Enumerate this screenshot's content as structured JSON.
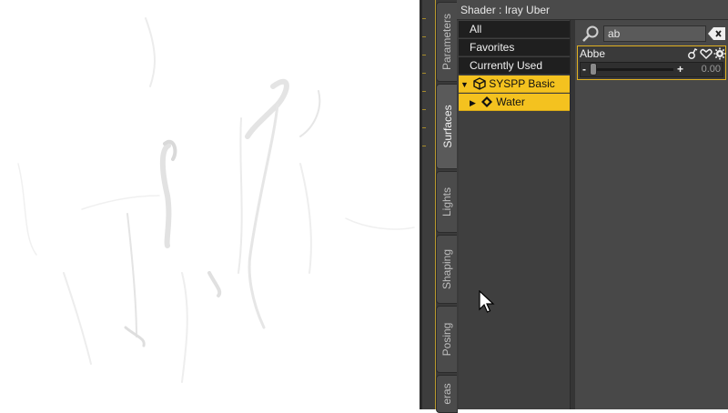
{
  "panel": {
    "title": "Shader : Iray Uber"
  },
  "tabs": [
    {
      "label": "Parameters"
    },
    {
      "label": "Surfaces"
    },
    {
      "label": "Lights"
    },
    {
      "label": "Shaping"
    },
    {
      "label": "Posing"
    },
    {
      "label": "eras"
    }
  ],
  "list": {
    "items": [
      {
        "label": "All"
      },
      {
        "label": "Favorites"
      },
      {
        "label": "Currently Used"
      }
    ],
    "tree": [
      {
        "label": "SYSPP Basic S..."
      },
      {
        "label": "Water"
      }
    ]
  },
  "search": {
    "value": "ab"
  },
  "property": {
    "name": "Abbe",
    "value": "0.00",
    "minus": "-",
    "plus": "+",
    "level": 0.0
  },
  "colors": {
    "accent": "#f4c21f",
    "panel": "#3b3b3b"
  },
  "icons": [
    "search-icon",
    "clear-icon",
    "lock-icon",
    "heart-icon",
    "gear-icon",
    "cube-icon",
    "material-icon",
    "expand-arrow-icon",
    "cursor-icon"
  ]
}
